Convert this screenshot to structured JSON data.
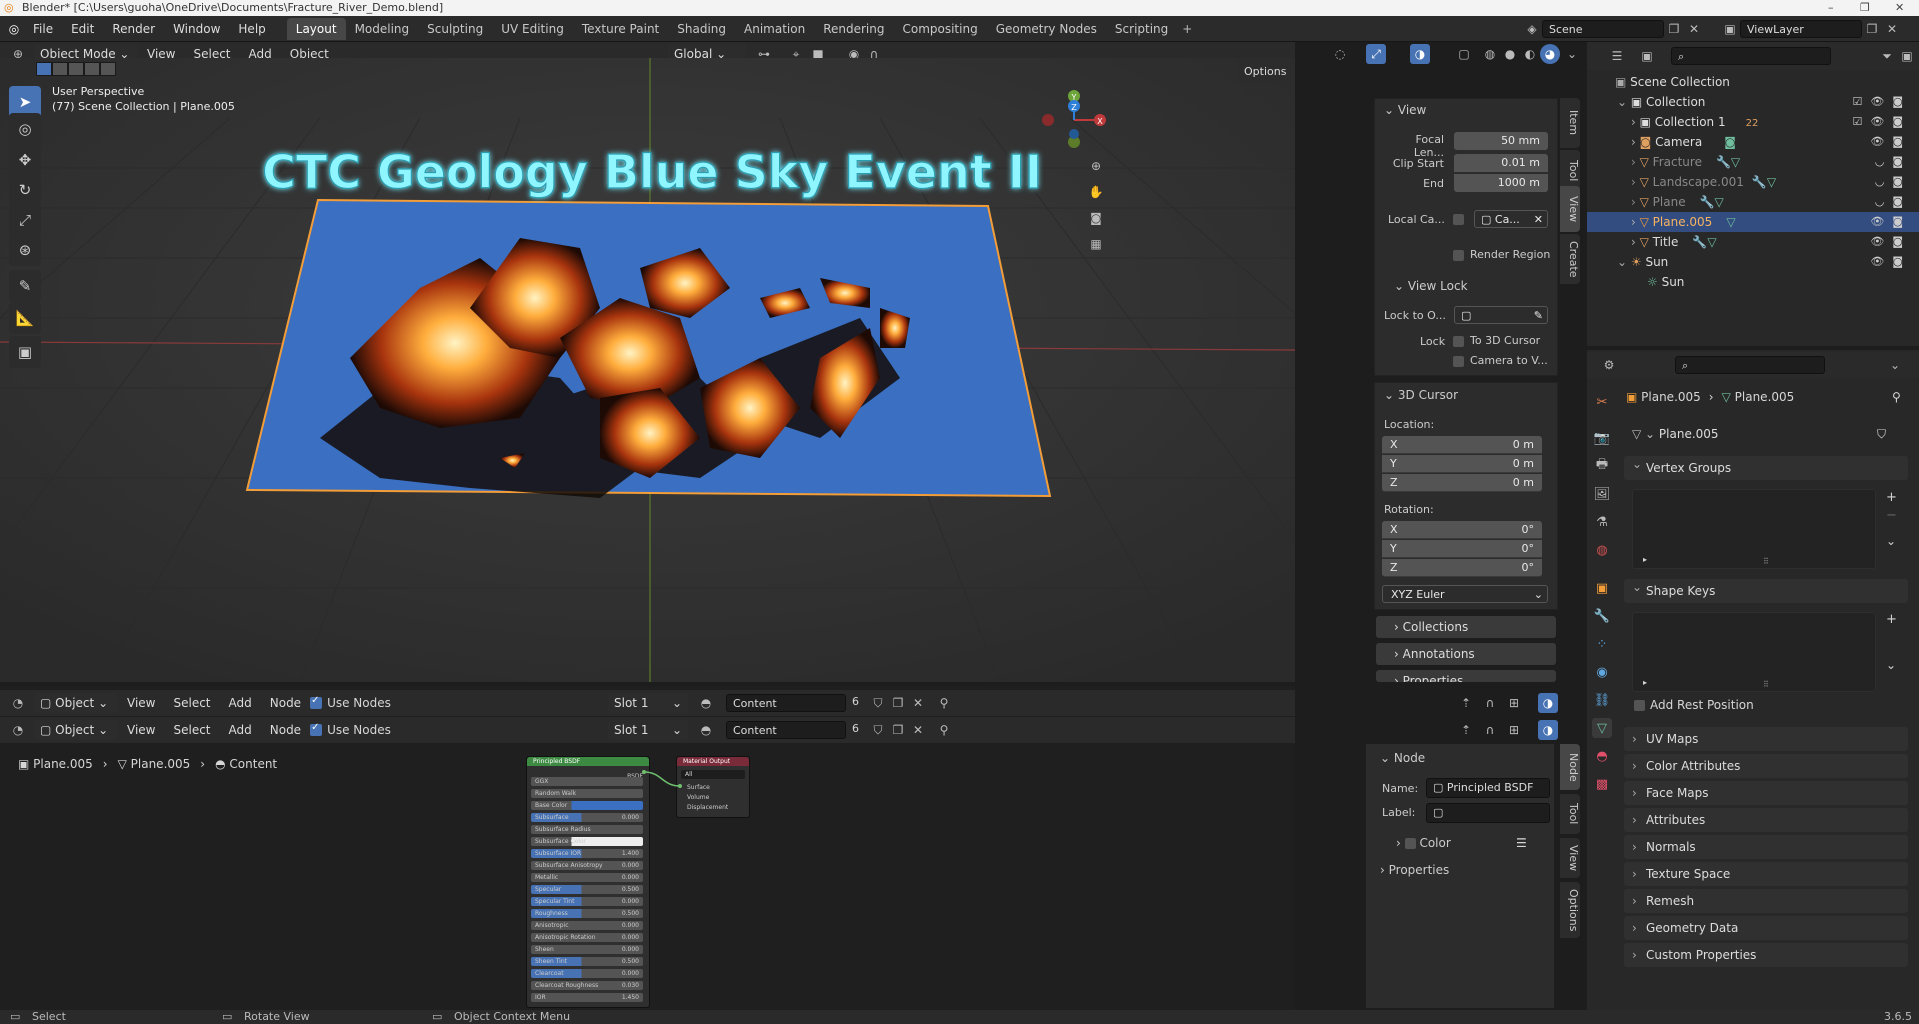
{
  "window": {
    "title": "Blender* [C:\\Users\\guoha\\OneDrive\\Documents\\Fracture_River_Demo.blend]",
    "controls": [
      "–",
      "❐",
      "✕"
    ]
  },
  "menubar": {
    "menus": [
      "File",
      "Edit",
      "Render",
      "Window",
      "Help"
    ],
    "workspaces": [
      "Layout",
      "Modeling",
      "Sculpting",
      "UV Editing",
      "Texture Paint",
      "Shading",
      "Animation",
      "Rendering",
      "Compositing",
      "Geometry Nodes",
      "Scripting"
    ],
    "active_workspace": "Layout",
    "scene": "Scene",
    "view_layer": "ViewLayer"
  },
  "viewport": {
    "mode": "Object Mode",
    "menus": [
      "View",
      "Select",
      "Add",
      "Object"
    ],
    "transform_orientation": "Global",
    "options_label": "Options",
    "overlay_title": "User Perspective",
    "overlay_subtitle": "(77) Scene Collection | Plane.005",
    "scene_text": "CTC Geology Blue Sky Event II",
    "gizmo": {
      "x": "X",
      "y": "Y",
      "z": "Z"
    }
  },
  "sidebar": {
    "tabs": [
      "Item",
      "Tool",
      "View",
      "Create"
    ],
    "view_header": "View",
    "focal_length_label": "Focal Len...",
    "focal_length": "50 mm",
    "clip_start_label": "Clip Start",
    "clip_start": "0.01 m",
    "clip_end_label": "End",
    "clip_end": "1000 m",
    "local_camera_label": "Local Ca...",
    "local_camera_value": "Ca...",
    "render_region": "Render Region",
    "view_lock_header": "View Lock",
    "lock_to_object_label": "Lock to O...",
    "lock_label": "Lock",
    "lock_to_cursor": "To 3D Cursor",
    "camera_to_view": "Camera to V...",
    "cursor_header": "3D Cursor",
    "location_label": "Location:",
    "location": [
      {
        "axis": "X",
        "value": "0 m"
      },
      {
        "axis": "Y",
        "value": "0 m"
      },
      {
        "axis": "Z",
        "value": "0 m"
      }
    ],
    "rotation_label": "Rotation:",
    "rotation": [
      {
        "axis": "X",
        "value": "0°"
      },
      {
        "axis": "Y",
        "value": "0°"
      },
      {
        "axis": "Z",
        "value": "0°"
      }
    ],
    "rotation_mode": "XYZ Euler",
    "collapsed": [
      "Collections",
      "Annotations",
      "Properties"
    ]
  },
  "node_editor": {
    "header_type": "Object",
    "menus": [
      "View",
      "Select",
      "Add",
      "Node"
    ],
    "use_nodes": "Use Nodes",
    "slot": "Slot 1",
    "material": "Content",
    "users": "6",
    "breadcrumb": [
      "Plane.005",
      "Plane.005",
      "Content"
    ],
    "bsdf_title": "Principled BSDF",
    "bsdf_output": "BSDF",
    "bsdf_rows": [
      "GGX",
      "Random Walk",
      "Base Color",
      "Subsurface",
      "Subsurface Radius",
      "Subsurface Color",
      "Subsurface IOR",
      "Subsurface Anisotropy",
      "Metallic",
      "Specular",
      "Specular Tint",
      "Roughness",
      "Anisotropic",
      "Anisotropic Rotation",
      "Sheen",
      "Sheen Tint",
      "Clearcoat",
      "Clearcoat Roughness",
      "IOR"
    ],
    "bsdf_values": [
      "",
      "",
      "",
      "0.000",
      "",
      "",
      "1.400",
      "0.000",
      "0.000",
      "0.500",
      "0.000",
      "0.500",
      "0.000",
      "0.000",
      "0.000",
      "0.500",
      "0.000",
      "0.030",
      "1.450"
    ],
    "output_title": "Material Output",
    "output_target": "All",
    "output_sockets": [
      "Surface",
      "Volume",
      "Displacement"
    ],
    "panel_tabs": [
      "Node",
      "Tool",
      "View",
      "Options"
    ],
    "node_header": "Node",
    "name_label": "Name:",
    "name_value": "Principled BSDF",
    "label_label": "Label:",
    "color_label": "Color",
    "properties_label": "Properties"
  },
  "outliner": {
    "root": "Scene Collection",
    "items": [
      {
        "name": "Collection",
        "icon": "collection-icon"
      },
      {
        "name": "Collection 1",
        "icon": "collection-icon"
      },
      {
        "name": "Camera",
        "icon": "camera-icon"
      },
      {
        "name": "Fracture",
        "icon": "mesh-icon"
      },
      {
        "name": "Landscape.001",
        "icon": "mesh-icon"
      },
      {
        "name": "Plane",
        "icon": "mesh-icon"
      },
      {
        "name": "Plane.005",
        "icon": "mesh-icon"
      },
      {
        "name": "Title",
        "icon": "mesh-icon"
      },
      {
        "name": "Sun",
        "icon": "light-icon"
      },
      {
        "name": "Sun",
        "icon": "light-data-icon"
      }
    ],
    "collection_count": "22"
  },
  "properties": {
    "breadcrumb_object": "Plane.005",
    "breadcrumb_data": "Plane.005",
    "mesh_name": "Plane.005",
    "open_sections": [
      "Vertex Groups",
      "Shape Keys"
    ],
    "add_rest_position": "Add Rest Position",
    "sections": [
      "UV Maps",
      "Color Attributes",
      "Face Maps",
      "Attributes",
      "Normals",
      "Texture Space",
      "Remesh",
      "Geometry Data",
      "Custom Properties"
    ]
  },
  "statusbar": {
    "items": [
      "Select",
      "Rotate View",
      "Object Context Menu"
    ],
    "version": "3.6.5"
  },
  "colors": {
    "accent": "#4772b3",
    "selection": "#334d80",
    "active_outline": "#f29d38",
    "plane_blue": "#3a6fc2",
    "title_glow": "#7ff0ff"
  }
}
